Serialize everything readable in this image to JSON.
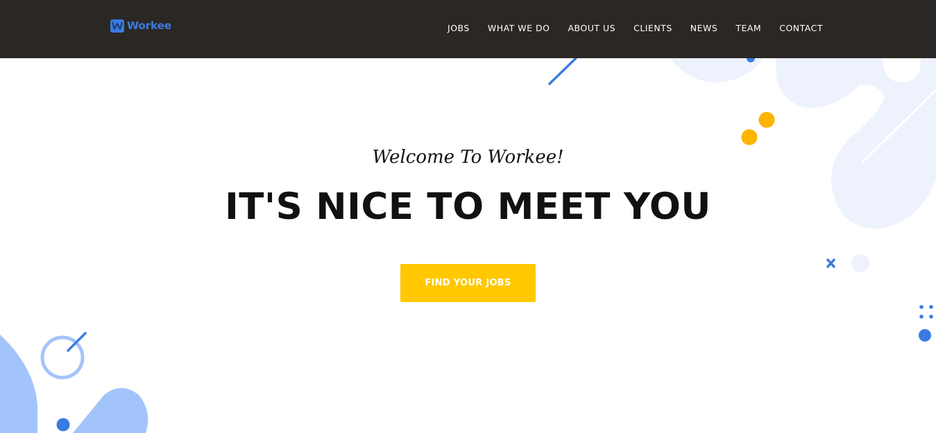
{
  "header": {
    "brand": "Workee",
    "logo_icon": "w-logo-icon",
    "nav": [
      {
        "label": "JOBS"
      },
      {
        "label": "WHAT WE DO"
      },
      {
        "label": "ABOUT US"
      },
      {
        "label": "CLIENTS"
      },
      {
        "label": "NEWS"
      },
      {
        "label": "TEAM"
      },
      {
        "label": "CONTACT"
      }
    ]
  },
  "hero": {
    "welcome": "Welcome To Workee!",
    "headline": "IT'S NICE TO MEET YOU",
    "cta_label": "FIND YOUR JOBS"
  },
  "colors": {
    "header_bg": "#2b2724",
    "brand_blue": "#3a7be0",
    "accent_yellow": "#ffc800",
    "light_blue_shape": "#eef2fc",
    "soft_blue_shape": "#a3c4fb"
  }
}
